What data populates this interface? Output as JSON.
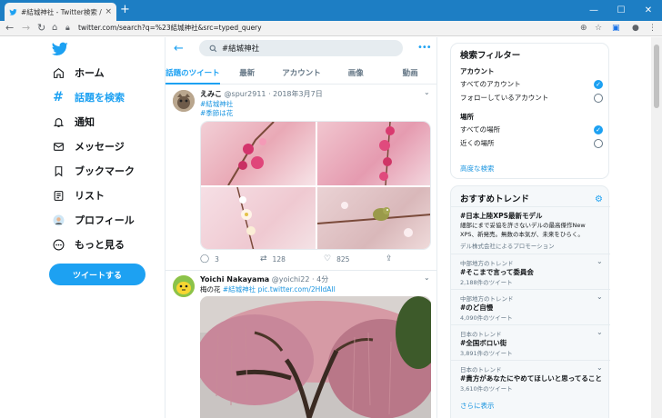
{
  "browser": {
    "tab_title": "#結城神社 - Twitter検索 / Twitter",
    "tab_close": "×",
    "new_tab": "+",
    "url": "twitter.com/search?q=%23結城神社&src=typed_query",
    "window_minimize": "—",
    "window_maximize": "☐",
    "window_close": "✕"
  },
  "nav": {
    "items": [
      {
        "label": "ホーム",
        "icon": "home-icon"
      },
      {
        "label": "話題を検索",
        "icon": "hashtag-icon"
      },
      {
        "label": "通知",
        "icon": "bell-icon"
      },
      {
        "label": "メッセージ",
        "icon": "mail-icon"
      },
      {
        "label": "ブックマーク",
        "icon": "bookmark-icon"
      },
      {
        "label": "リスト",
        "icon": "list-icon"
      },
      {
        "label": "プロフィール",
        "icon": "avatar-icon"
      },
      {
        "label": "もっと見る",
        "icon": "more-icon"
      }
    ],
    "tweet_button": "ツイートする"
  },
  "search": {
    "query": "#結城神社",
    "tabs": [
      "話題のツイート",
      "最新",
      "アカウント",
      "画像",
      "動画"
    ]
  },
  "tweets": [
    {
      "name": "えみこ",
      "handle": "@spur2911",
      "sep": "·",
      "date": "2018年3月7日",
      "tags": [
        "#結城神社",
        "#季節は花"
      ],
      "replies": "3",
      "retweets": "128",
      "likes": "825"
    },
    {
      "name": "Yoichi Nakayama",
      "handle": "@yoichi22",
      "sep": "·",
      "date": "4分",
      "text_prefix": "梅の花",
      "tag": "#結城神社",
      "link": "pic.twitter.com/2HIdAII"
    }
  ],
  "filter": {
    "title": "検索フィルター",
    "account_section": "アカウント",
    "account_options": [
      "すべてのアカウント",
      "フォローしているアカウント"
    ],
    "place_section": "場所",
    "place_options": [
      "すべての場所",
      "近くの場所"
    ],
    "advanced": "高度な検索",
    "check_glyph": "✓"
  },
  "trends": {
    "title": "おすすめトレンド",
    "promo": {
      "title": "#日本上陸XPS最新モデル",
      "text": "細部にまで妥協を許さないデルの最高傑作New XPS、新発売。無数の本気が、未来をひらく。",
      "by": "デル株式会社によるプロモーション"
    },
    "items": [
      {
        "context": "中部地方のトレンド",
        "title": "#そこまで言って委員会",
        "count": "2,188件のツイート"
      },
      {
        "context": "中部地方のトレンド",
        "title": "#のど自慢",
        "count": "4,090件のツイート"
      },
      {
        "context": "日本のトレンド",
        "title": "#全国ボロい街",
        "count": "3,891件のツイート"
      },
      {
        "context": "日本のトレンド",
        "title": "#貴方があなたにやめてほしいと思ってること",
        "count": "3,610件のツイート"
      }
    ],
    "more": "さらに表示"
  },
  "colors": {
    "accent": "#1da1f2",
    "chrome": "#1d7ec4"
  }
}
